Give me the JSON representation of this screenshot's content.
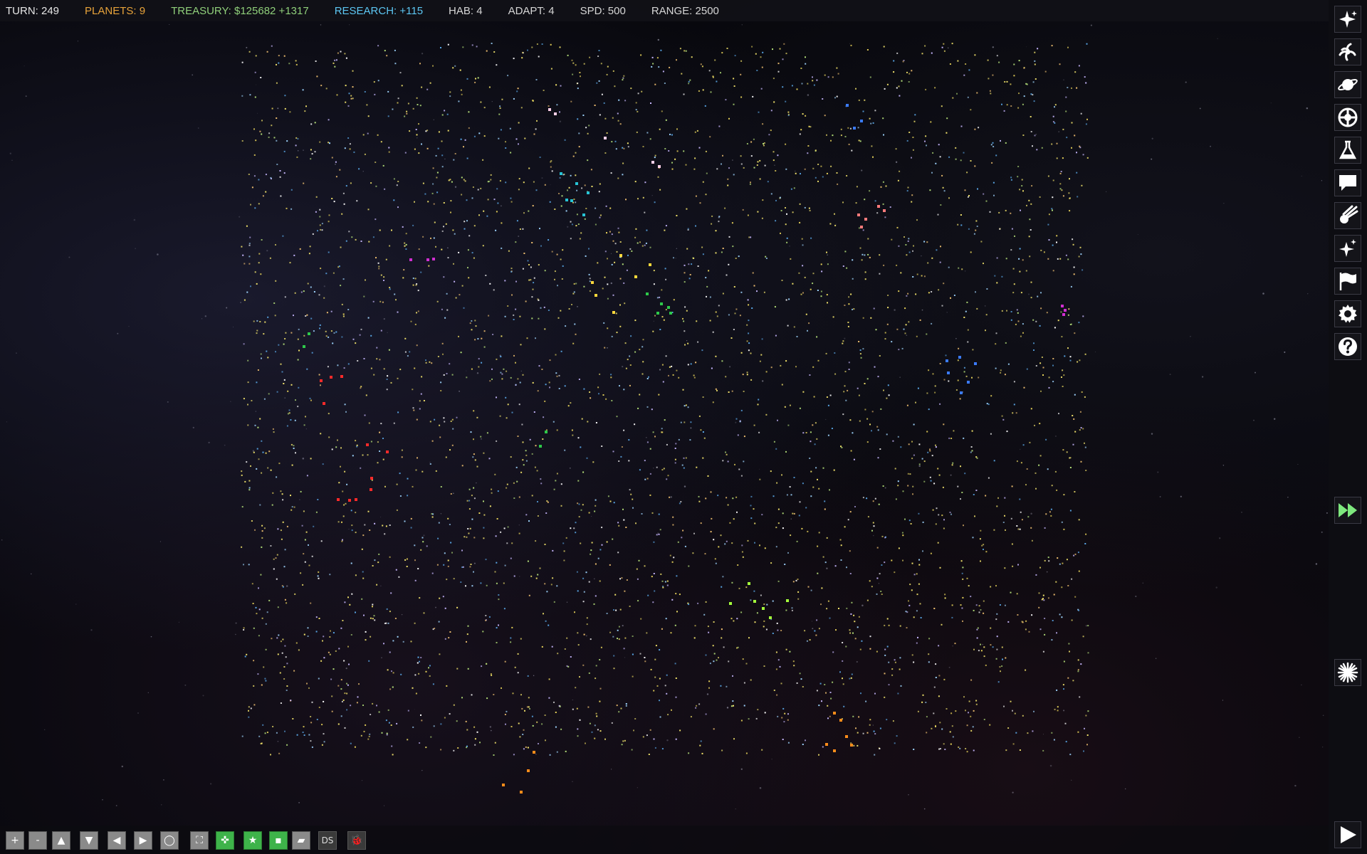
{
  "status": {
    "turn": "TURN: 249",
    "planets": "PLANETS: 9",
    "treasury": "TREASURY: $125682 +1317",
    "research": "RESEARCH: +115",
    "hab": "HAB: 4",
    "adapt": "ADAPT: 4",
    "spd": "SPD: 500",
    "range": "RANGE: 2500"
  },
  "colors": {
    "turn": "#e6e6e6",
    "planets": "#e8a33a",
    "treasury": "#8fcf7a",
    "research": "#5cc6f2",
    "neutral": "#d6d6d6",
    "accent_green": "#3eb34a",
    "fast_forward": "#7ee87e"
  },
  "sidebar": {
    "buttons": [
      {
        "icon": "sparkle-star-icon"
      },
      {
        "icon": "spiral-galaxy-icon"
      },
      {
        "icon": "ringed-planet-icon"
      },
      {
        "icon": "shield-emblem-icon"
      },
      {
        "icon": "flask-icon"
      },
      {
        "icon": "chat-bubble-icon"
      },
      {
        "icon": "comet-icon"
      },
      {
        "icon": "sparkles-icon"
      },
      {
        "icon": "flag-icon"
      },
      {
        "icon": "gear-icon"
      },
      {
        "icon": "help-icon"
      }
    ],
    "fast_forward_icon": "fast-forward-icon",
    "nova_icon": "starburst-icon",
    "play_icon": "play-icon"
  },
  "bottombar": {
    "buttons": [
      {
        "label": "+",
        "icon": "zoom-in-icon"
      },
      {
        "label": "-",
        "icon": "zoom-out-icon"
      },
      {
        "label": "▲",
        "icon": "arrow-up-icon"
      },
      {
        "label": "▼",
        "icon": "arrow-down-icon"
      },
      {
        "label": "◀",
        "icon": "arrow-left-icon"
      },
      {
        "label": "▶",
        "icon": "arrow-right-icon"
      },
      {
        "label": "◯",
        "icon": "circle-icon"
      },
      {
        "label": "⛶",
        "icon": "fullscreen-icon"
      },
      {
        "label": "✜",
        "icon": "move-icon"
      },
      {
        "label": "★",
        "icon": "star-icon"
      },
      {
        "label": "▪",
        "icon": "square-icon"
      },
      {
        "label": "▰",
        "icon": "parallelogram-icon"
      },
      {
        "label": "DS",
        "icon": "ds-icon"
      },
      {
        "label": "🐞",
        "icon": "bug-icon"
      }
    ]
  },
  "empires": [
    {
      "color": "#ff2a2a"
    },
    {
      "color": "#d12fd1"
    },
    {
      "color": "#2ec94a"
    },
    {
      "color": "#27c4d6"
    },
    {
      "color": "#ffd93b"
    },
    {
      "color": "#3b7bff"
    },
    {
      "color": "#ff8c1a"
    },
    {
      "color": "#ff7b7b"
    },
    {
      "color": "#a4ff3b"
    },
    {
      "color": "#ffd0e8"
    }
  ]
}
